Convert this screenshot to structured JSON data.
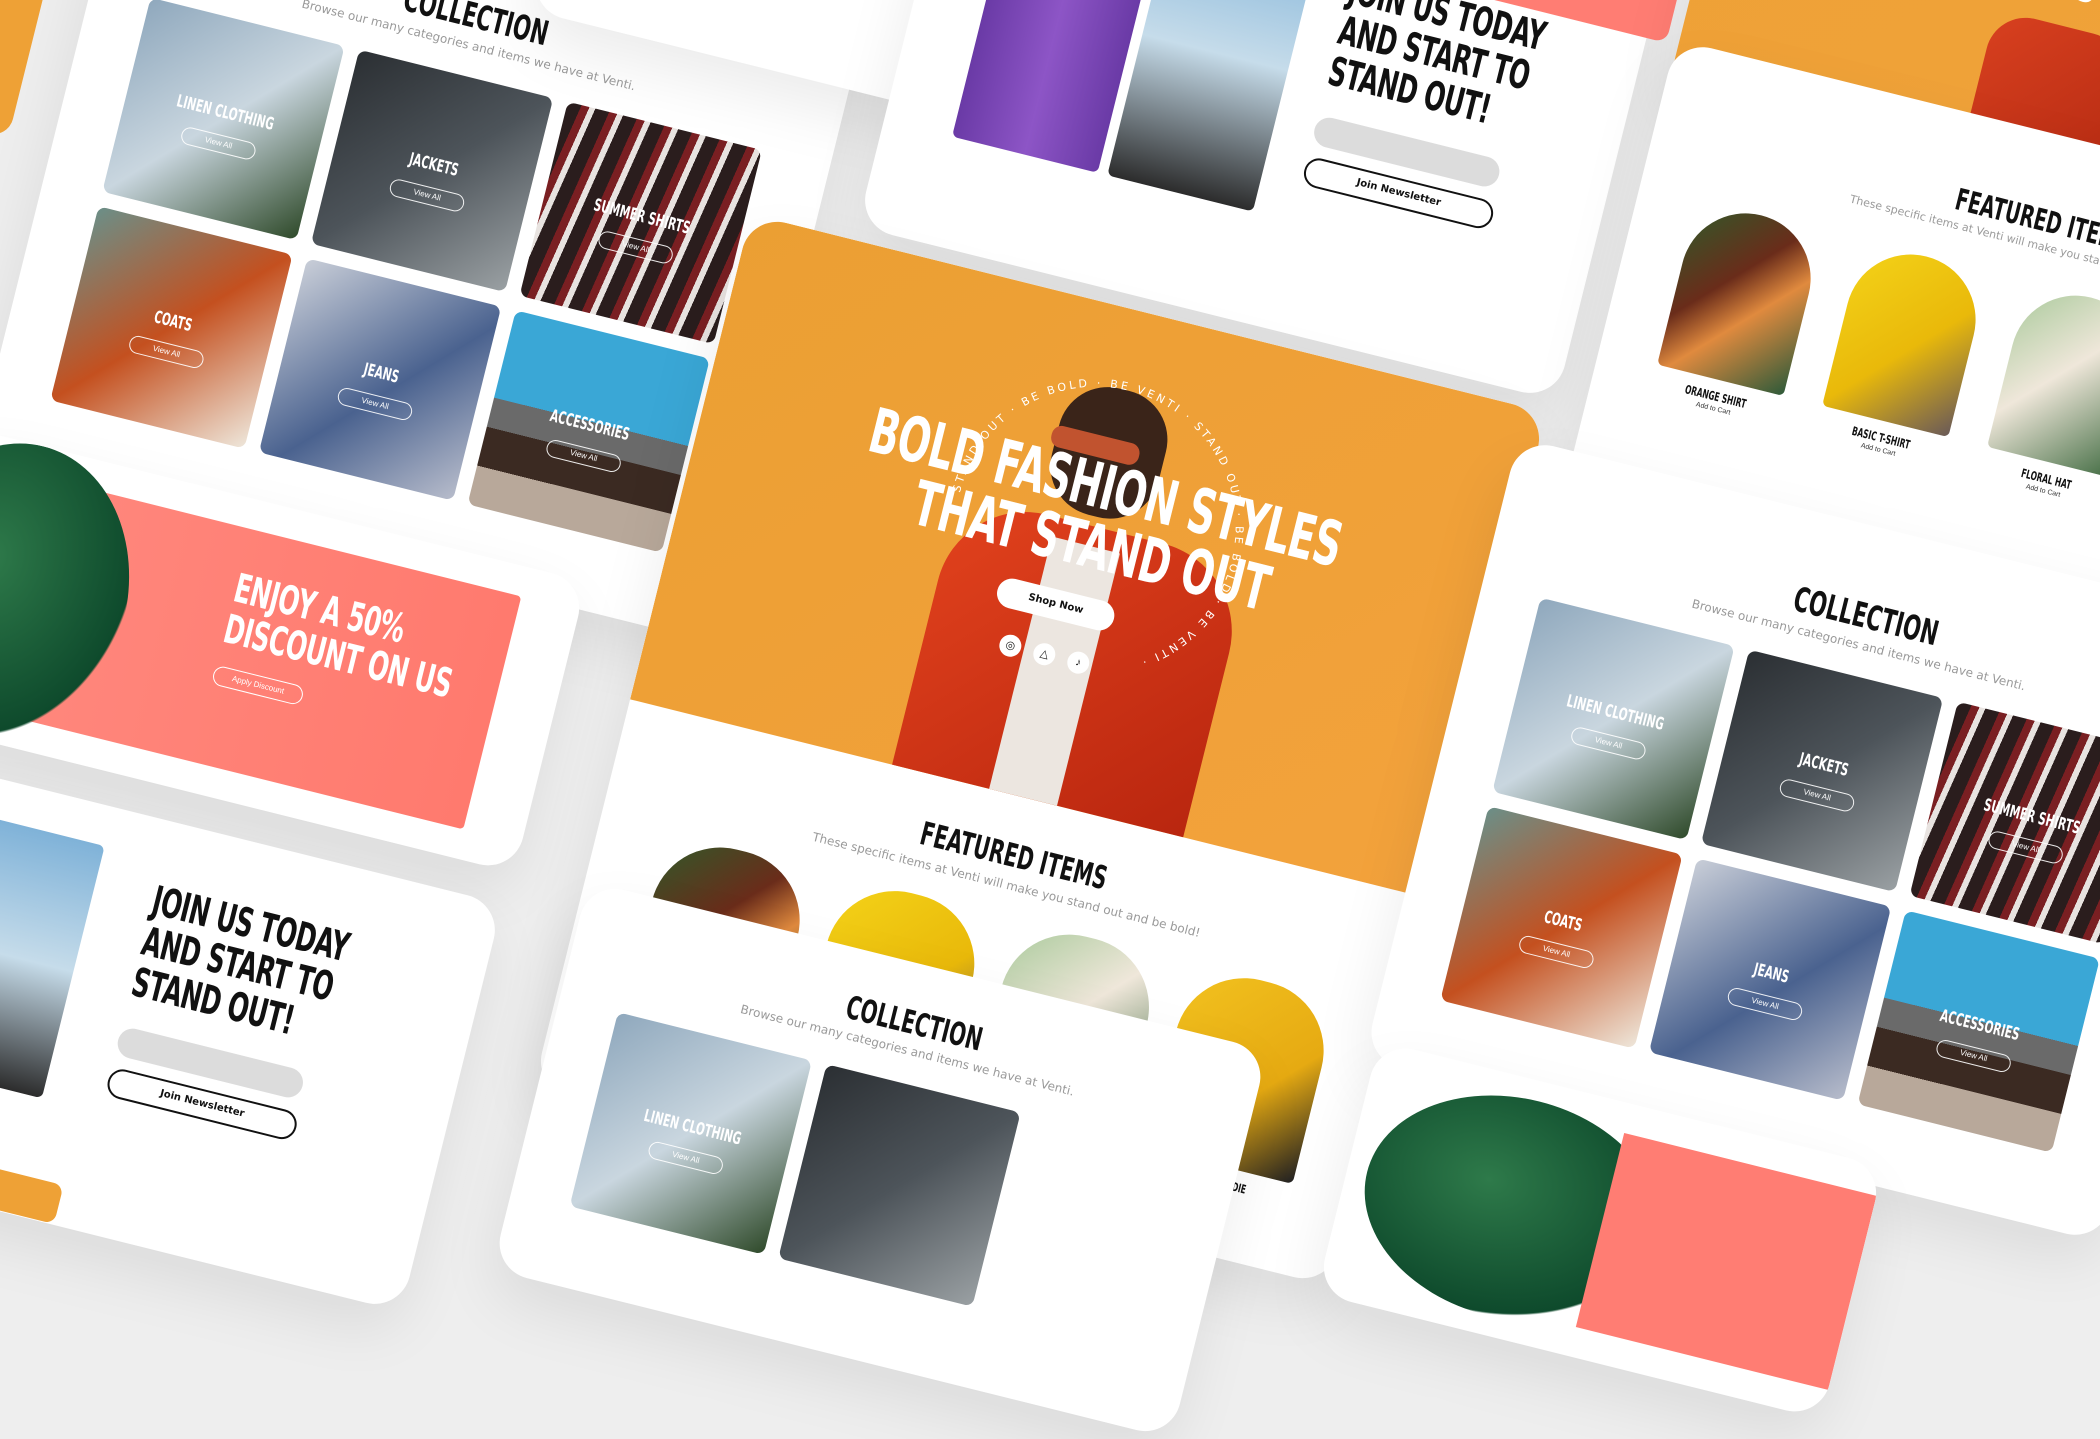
{
  "brand": "Venti",
  "colors": {
    "hero_orange": "#EEA136",
    "discount_coral": "#FF7D73",
    "black": "#111111",
    "muted": "#9A9A9A"
  },
  "collection": {
    "title": "COLLECTION",
    "subtitle": "Browse our many categories and items we have at Venti.",
    "view_all_label": "View All",
    "categories": [
      {
        "label": "LINEN CLOTHING"
      },
      {
        "label": "JACKETS"
      },
      {
        "label": "COATS"
      },
      {
        "label": "SUMMER SHIRTS"
      },
      {
        "label": "JEANS"
      },
      {
        "label": "ACCESSORIES"
      }
    ]
  },
  "hero": {
    "headline_line1": "BOLD FASHION STYLES",
    "headline_line2": "THAT STAND OUT",
    "cta_label": "Shop Now",
    "ring_text": "STAND OUT · BE BOLD · BE VENTI · STAND OUT · BE BOLD · BE VENTI · ",
    "social_icons": [
      "instagram-icon",
      "snapchat-icon",
      "tiktok-icon"
    ]
  },
  "featured": {
    "title": "FEATURED ITEMS",
    "subtitle": "These specific items at Venti will make you stand out and be bold!",
    "add_to_cart_label": "Add to Cart",
    "items": [
      {
        "name": "ORANGE SHIRT"
      },
      {
        "name": "BASIC T-SHIRT"
      },
      {
        "name": "FLORAL HAT"
      },
      {
        "name": "WHITE HOODIE"
      }
    ]
  },
  "newsletter": {
    "headline_line1": "JOIN US TODAY",
    "headline_line2": "AND START TO",
    "headline_line3": "STAND OUT!",
    "button_label": "Join Newsletter"
  },
  "discount": {
    "headline_line1": "ENJOY A 50%",
    "headline_line2": "DISCOUNT ON US",
    "button_label": "Apply Discount"
  },
  "partial_hero_text": "THAT ST"
}
